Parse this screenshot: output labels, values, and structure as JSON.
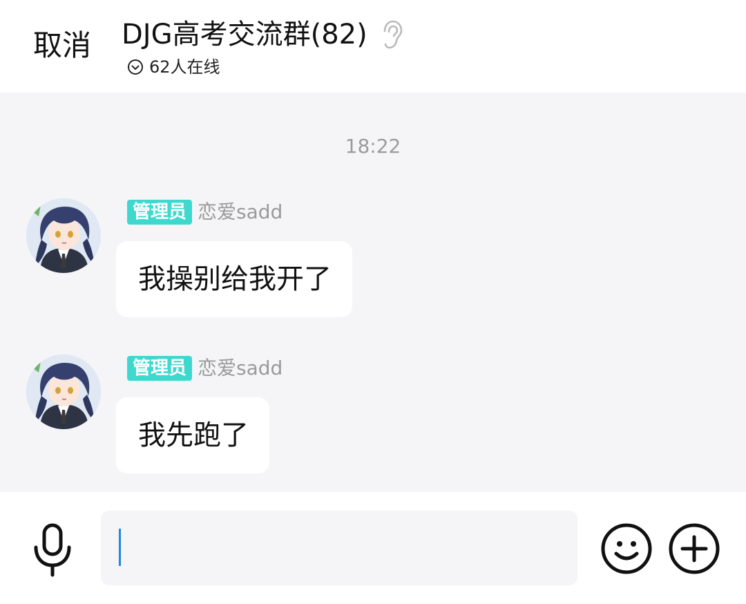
{
  "header": {
    "cancel_label": "取消",
    "title": "DJG高考交流群(82)",
    "online_text": "62人在线",
    "icons": {
      "ear": "ear-icon",
      "online": "chevron-down-circle-icon"
    }
  },
  "chat": {
    "timestamp": "18:22",
    "messages": [
      {
        "badge": "管理员",
        "sender": "恋爱sadd",
        "text": "我操别给我开了",
        "avatar": "anime-girl-avatar"
      },
      {
        "badge": "管理员",
        "sender": "恋爱sadd",
        "text": "我先跑了",
        "avatar": "anime-girl-avatar"
      }
    ]
  },
  "input_bar": {
    "placeholder": "",
    "icons": {
      "mic": "microphone-icon",
      "emoji": "smiley-icon",
      "plus": "plus-circle-icon"
    }
  },
  "colors": {
    "badge_bg": "#3fd8cf",
    "chat_bg": "#f5f4f7",
    "caret": "#1e88e5",
    "timestamp": "#9b9b9b"
  }
}
